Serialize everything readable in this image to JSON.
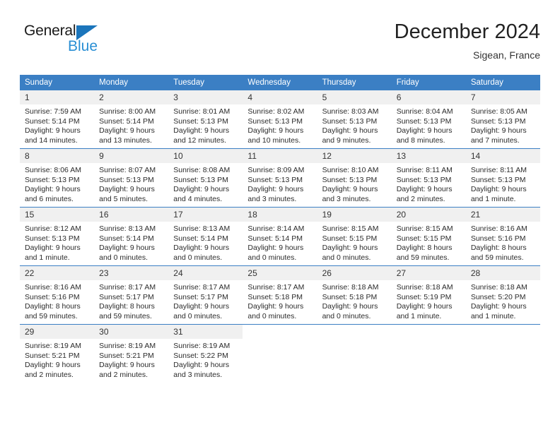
{
  "brand": {
    "name_top": "General",
    "name_bottom": "Blue",
    "accent_color": "#1b75bb",
    "accent_color_light": "#2a8fd4"
  },
  "header": {
    "title": "December 2024",
    "subtitle": "Sigean, France"
  },
  "theme": {
    "header_row_bg": "#3b7fc4",
    "daynum_bg": "#f0f0f0",
    "grid_line": "#3b7fc4",
    "text": "#2b2b2b"
  },
  "weekdays": [
    "Sunday",
    "Monday",
    "Tuesday",
    "Wednesday",
    "Thursday",
    "Friday",
    "Saturday"
  ],
  "weeks": [
    [
      {
        "day": "1",
        "sunrise": "Sunrise: 7:59 AM",
        "sunset": "Sunset: 5:14 PM",
        "daylight1": "Daylight: 9 hours",
        "daylight2": "and 14 minutes."
      },
      {
        "day": "2",
        "sunrise": "Sunrise: 8:00 AM",
        "sunset": "Sunset: 5:14 PM",
        "daylight1": "Daylight: 9 hours",
        "daylight2": "and 13 minutes."
      },
      {
        "day": "3",
        "sunrise": "Sunrise: 8:01 AM",
        "sunset": "Sunset: 5:13 PM",
        "daylight1": "Daylight: 9 hours",
        "daylight2": "and 12 minutes."
      },
      {
        "day": "4",
        "sunrise": "Sunrise: 8:02 AM",
        "sunset": "Sunset: 5:13 PM",
        "daylight1": "Daylight: 9 hours",
        "daylight2": "and 10 minutes."
      },
      {
        "day": "5",
        "sunrise": "Sunrise: 8:03 AM",
        "sunset": "Sunset: 5:13 PM",
        "daylight1": "Daylight: 9 hours",
        "daylight2": "and 9 minutes."
      },
      {
        "day": "6",
        "sunrise": "Sunrise: 8:04 AM",
        "sunset": "Sunset: 5:13 PM",
        "daylight1": "Daylight: 9 hours",
        "daylight2": "and 8 minutes."
      },
      {
        "day": "7",
        "sunrise": "Sunrise: 8:05 AM",
        "sunset": "Sunset: 5:13 PM",
        "daylight1": "Daylight: 9 hours",
        "daylight2": "and 7 minutes."
      }
    ],
    [
      {
        "day": "8",
        "sunrise": "Sunrise: 8:06 AM",
        "sunset": "Sunset: 5:13 PM",
        "daylight1": "Daylight: 9 hours",
        "daylight2": "and 6 minutes."
      },
      {
        "day": "9",
        "sunrise": "Sunrise: 8:07 AM",
        "sunset": "Sunset: 5:13 PM",
        "daylight1": "Daylight: 9 hours",
        "daylight2": "and 5 minutes."
      },
      {
        "day": "10",
        "sunrise": "Sunrise: 8:08 AM",
        "sunset": "Sunset: 5:13 PM",
        "daylight1": "Daylight: 9 hours",
        "daylight2": "and 4 minutes."
      },
      {
        "day": "11",
        "sunrise": "Sunrise: 8:09 AM",
        "sunset": "Sunset: 5:13 PM",
        "daylight1": "Daylight: 9 hours",
        "daylight2": "and 3 minutes."
      },
      {
        "day": "12",
        "sunrise": "Sunrise: 8:10 AM",
        "sunset": "Sunset: 5:13 PM",
        "daylight1": "Daylight: 9 hours",
        "daylight2": "and 3 minutes."
      },
      {
        "day": "13",
        "sunrise": "Sunrise: 8:11 AM",
        "sunset": "Sunset: 5:13 PM",
        "daylight1": "Daylight: 9 hours",
        "daylight2": "and 2 minutes."
      },
      {
        "day": "14",
        "sunrise": "Sunrise: 8:11 AM",
        "sunset": "Sunset: 5:13 PM",
        "daylight1": "Daylight: 9 hours",
        "daylight2": "and 1 minute."
      }
    ],
    [
      {
        "day": "15",
        "sunrise": "Sunrise: 8:12 AM",
        "sunset": "Sunset: 5:13 PM",
        "daylight1": "Daylight: 9 hours",
        "daylight2": "and 1 minute."
      },
      {
        "day": "16",
        "sunrise": "Sunrise: 8:13 AM",
        "sunset": "Sunset: 5:14 PM",
        "daylight1": "Daylight: 9 hours",
        "daylight2": "and 0 minutes."
      },
      {
        "day": "17",
        "sunrise": "Sunrise: 8:13 AM",
        "sunset": "Sunset: 5:14 PM",
        "daylight1": "Daylight: 9 hours",
        "daylight2": "and 0 minutes."
      },
      {
        "day": "18",
        "sunrise": "Sunrise: 8:14 AM",
        "sunset": "Sunset: 5:14 PM",
        "daylight1": "Daylight: 9 hours",
        "daylight2": "and 0 minutes."
      },
      {
        "day": "19",
        "sunrise": "Sunrise: 8:15 AM",
        "sunset": "Sunset: 5:15 PM",
        "daylight1": "Daylight: 9 hours",
        "daylight2": "and 0 minutes."
      },
      {
        "day": "20",
        "sunrise": "Sunrise: 8:15 AM",
        "sunset": "Sunset: 5:15 PM",
        "daylight1": "Daylight: 8 hours",
        "daylight2": "and 59 minutes."
      },
      {
        "day": "21",
        "sunrise": "Sunrise: 8:16 AM",
        "sunset": "Sunset: 5:16 PM",
        "daylight1": "Daylight: 8 hours",
        "daylight2": "and 59 minutes."
      }
    ],
    [
      {
        "day": "22",
        "sunrise": "Sunrise: 8:16 AM",
        "sunset": "Sunset: 5:16 PM",
        "daylight1": "Daylight: 8 hours",
        "daylight2": "and 59 minutes."
      },
      {
        "day": "23",
        "sunrise": "Sunrise: 8:17 AM",
        "sunset": "Sunset: 5:17 PM",
        "daylight1": "Daylight: 8 hours",
        "daylight2": "and 59 minutes."
      },
      {
        "day": "24",
        "sunrise": "Sunrise: 8:17 AM",
        "sunset": "Sunset: 5:17 PM",
        "daylight1": "Daylight: 9 hours",
        "daylight2": "and 0 minutes."
      },
      {
        "day": "25",
        "sunrise": "Sunrise: 8:17 AM",
        "sunset": "Sunset: 5:18 PM",
        "daylight1": "Daylight: 9 hours",
        "daylight2": "and 0 minutes."
      },
      {
        "day": "26",
        "sunrise": "Sunrise: 8:18 AM",
        "sunset": "Sunset: 5:18 PM",
        "daylight1": "Daylight: 9 hours",
        "daylight2": "and 0 minutes."
      },
      {
        "day": "27",
        "sunrise": "Sunrise: 8:18 AM",
        "sunset": "Sunset: 5:19 PM",
        "daylight1": "Daylight: 9 hours",
        "daylight2": "and 1 minute."
      },
      {
        "day": "28",
        "sunrise": "Sunrise: 8:18 AM",
        "sunset": "Sunset: 5:20 PM",
        "daylight1": "Daylight: 9 hours",
        "daylight2": "and 1 minute."
      }
    ],
    [
      {
        "day": "29",
        "sunrise": "Sunrise: 8:19 AM",
        "sunset": "Sunset: 5:21 PM",
        "daylight1": "Daylight: 9 hours",
        "daylight2": "and 2 minutes."
      },
      {
        "day": "30",
        "sunrise": "Sunrise: 8:19 AM",
        "sunset": "Sunset: 5:21 PM",
        "daylight1": "Daylight: 9 hours",
        "daylight2": "and 2 minutes."
      },
      {
        "day": "31",
        "sunrise": "Sunrise: 8:19 AM",
        "sunset": "Sunset: 5:22 PM",
        "daylight1": "Daylight: 9 hours",
        "daylight2": "and 3 minutes."
      },
      {
        "day": "",
        "sunrise": "",
        "sunset": "",
        "daylight1": "",
        "daylight2": ""
      },
      {
        "day": "",
        "sunrise": "",
        "sunset": "",
        "daylight1": "",
        "daylight2": ""
      },
      {
        "day": "",
        "sunrise": "",
        "sunset": "",
        "daylight1": "",
        "daylight2": ""
      },
      {
        "day": "",
        "sunrise": "",
        "sunset": "",
        "daylight1": "",
        "daylight2": ""
      }
    ]
  ]
}
